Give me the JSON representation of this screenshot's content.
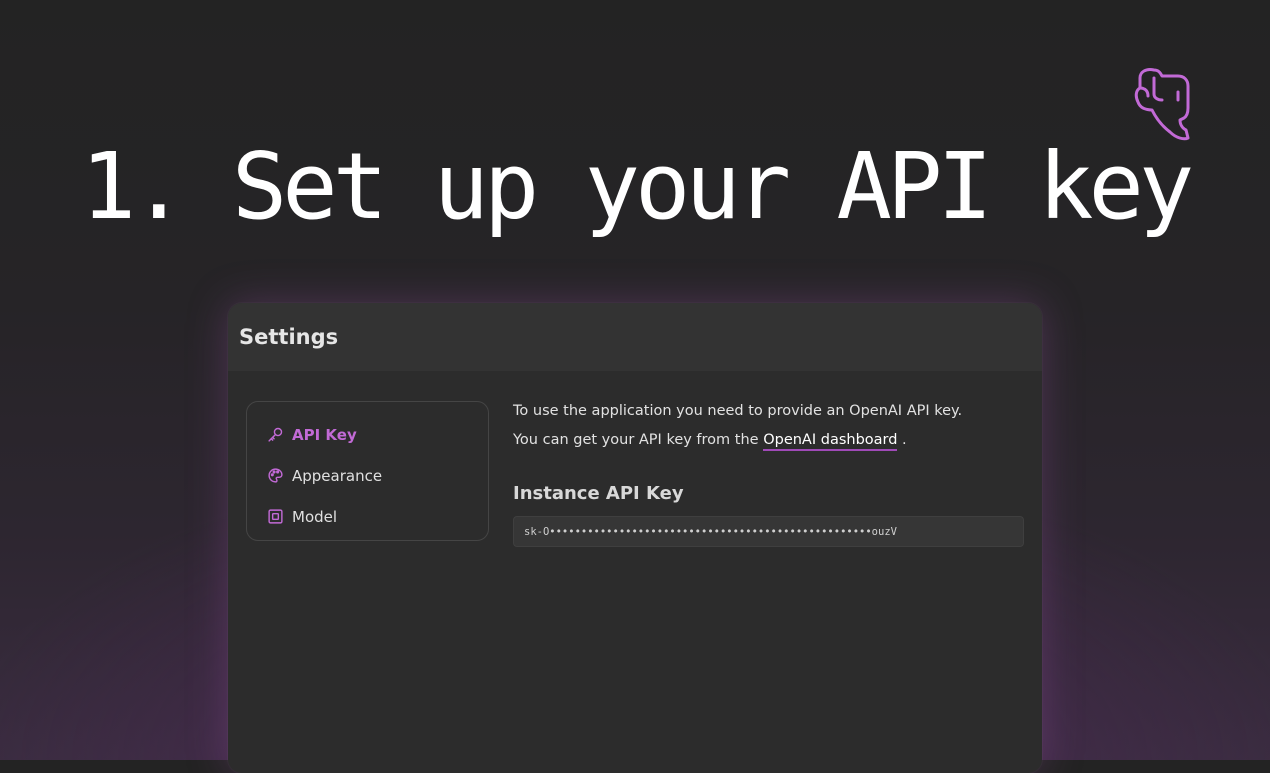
{
  "headline": "1. Set up your API key",
  "brand_color": "#c26ad6",
  "logo_icon": "elephant-head-icon",
  "window": {
    "title": "Settings"
  },
  "nav": {
    "items": [
      {
        "label": "API Key",
        "icon": "key-icon",
        "active": true
      },
      {
        "label": "Appearance",
        "icon": "palette-icon",
        "active": false
      },
      {
        "label": "Model",
        "icon": "chip-icon",
        "active": false
      }
    ]
  },
  "content": {
    "intro": "To use the application you need to provide an OpenAI API key.",
    "get_key_prefix": "You can get your API key from the ",
    "get_key_link": "OpenAI dashboard",
    "get_key_suffix": " .",
    "section_title": "Instance API Key",
    "api_key_value": "sk-O•••••••••••••••••••••••••••••••••••••••••••••••••••ouzV"
  }
}
